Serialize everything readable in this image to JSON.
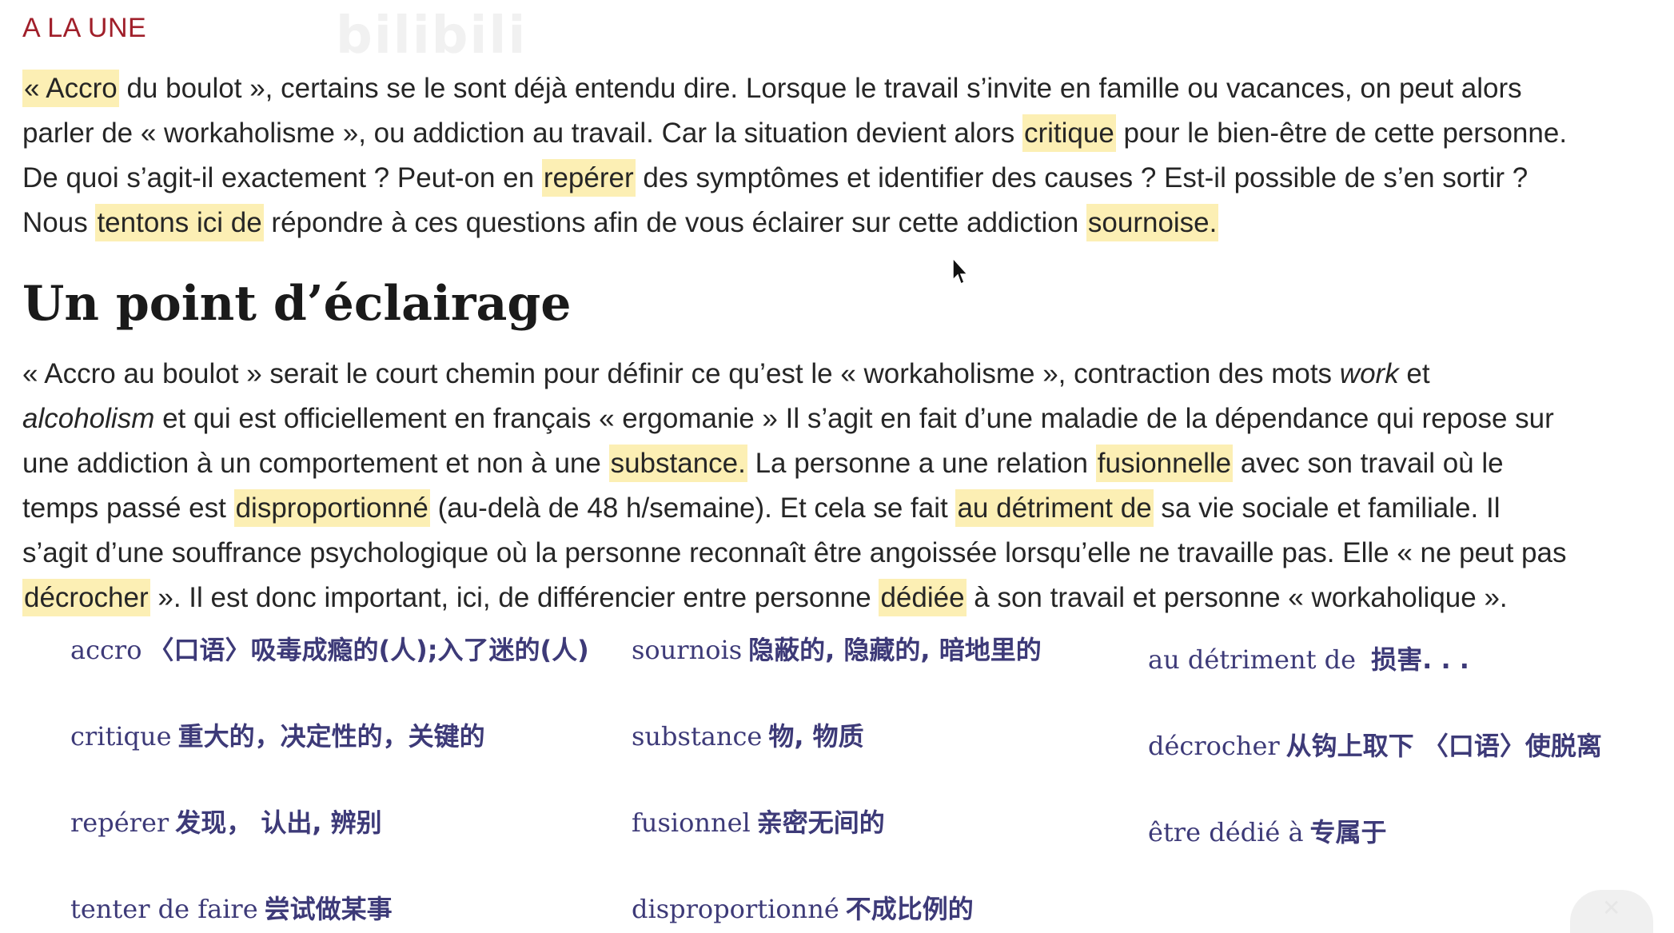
{
  "header": {
    "section": "A LA UNE",
    "watermark": "bilibili"
  },
  "article": {
    "intro_lines": [
      [
        {
          "t": "« Accro",
          "hl": true
        },
        {
          "t": " du boulot », certains se le sont déjà entendu dire. Lorsque le travail s’invite en famille ou vacances, on peut alors",
          "hl": false
        }
      ],
      [
        {
          "t": "parler de « workaholisme », ou addiction au travail. Car la situation devient alors ",
          "hl": false
        },
        {
          "t": "critique",
          "hl": true
        },
        {
          "t": " pour le bien-être de cette personne.",
          "hl": false
        }
      ],
      [
        {
          "t": "De quoi s’agit-il exactement ? Peut-on en ",
          "hl": false
        },
        {
          "t": "repérer",
          "hl": true
        },
        {
          "t": " des symptômes et identifier des causes ? Est-il possible de s’en sortir ?",
          "hl": false
        }
      ],
      [
        {
          "t": "Nous ",
          "hl": false
        },
        {
          "t": "tentons ici de",
          "hl": true
        },
        {
          "t": " répondre à ces questions afin de vous éclairer sur cette addiction ",
          "hl": false
        },
        {
          "t": "sournoise.",
          "hl": true
        }
      ]
    ],
    "heading": "Un point d’éclairage",
    "body_lines": [
      [
        {
          "t": "« Accro au boulot » serait le court chemin pour définir ce qu’est le « workaholisme », contraction des mots ",
          "hl": false
        },
        {
          "t": "work",
          "hl": false,
          "em": true
        },
        {
          "t": " et",
          "hl": false
        }
      ],
      [
        {
          "t": "alcoholism",
          "hl": false,
          "em": true
        },
        {
          "t": " et qui est officiellement en français « ergomanie » Il s’agit en fait d’une maladie de la dépendance qui repose sur",
          "hl": false
        }
      ],
      [
        {
          "t": "une addiction à un comportement et non à une ",
          "hl": false
        },
        {
          "t": "substance.",
          "hl": true
        },
        {
          "t": " La personne a une relation ",
          "hl": false
        },
        {
          "t": "fusionnelle",
          "hl": true
        },
        {
          "t": " avec son travail où le",
          "hl": false
        }
      ],
      [
        {
          "t": "temps passé est ",
          "hl": false
        },
        {
          "t": "disproportionné",
          "hl": true
        },
        {
          "t": " (au-delà de 48 h/semaine). Et cela se fait ",
          "hl": false
        },
        {
          "t": "au détriment de",
          "hl": true
        },
        {
          "t": " sa vie sociale et familiale. Il",
          "hl": false
        }
      ],
      [
        {
          "t": "s’agit d’une souffrance psychologique où la personne reconnaît être angoissée lorsqu’elle ne travaille pas. Elle « ne peut pas",
          "hl": false
        }
      ],
      [
        {
          "t": "décrocher",
          "hl": true
        },
        {
          "t": " ». Il est donc important, ici, de différencier entre personne ",
          "hl": false
        },
        {
          "t": "dédiée",
          "hl": true
        },
        {
          "t": " à son travail et personne « workaholique ».",
          "hl": false
        }
      ]
    ]
  },
  "vocabulary": [
    {
      "fr": "accro",
      "zh": "〈口语〉吸毒成瘾的(人);入了迷的(人)"
    },
    {
      "fr": "critique",
      "zh": "重大的，决定性的，关键的"
    },
    {
      "fr": "repérer",
      "zh": "发现， 认出, 辨别"
    },
    {
      "fr": "tenter de faire",
      "zh": "尝试做某事"
    },
    {
      "fr": "sournois",
      "zh": "隐蔽的, 隐藏的, 暗地里的"
    },
    {
      "fr": "substance",
      "zh": "物, 物质"
    },
    {
      "fr": "fusionnel",
      "zh": "亲密无间的"
    },
    {
      "fr": "disproportionné",
      "zh": "不成比例的"
    },
    {
      "fr": "au détriment de",
      "zh": " 损害. . ."
    },
    {
      "fr": "décrocher",
      "zh": "从钩上取下 〈口语〉使脱离"
    },
    {
      "fr": "être dédié à",
      "zh": "专属于"
    }
  ],
  "colors": {
    "highlight": "#fcefb4",
    "section_tag": "#a01f2a",
    "vocab_text": "#3d3a78"
  },
  "icons": {
    "cursor": "mouse-pointer-icon",
    "corner": "bilibili-tv-icon"
  }
}
